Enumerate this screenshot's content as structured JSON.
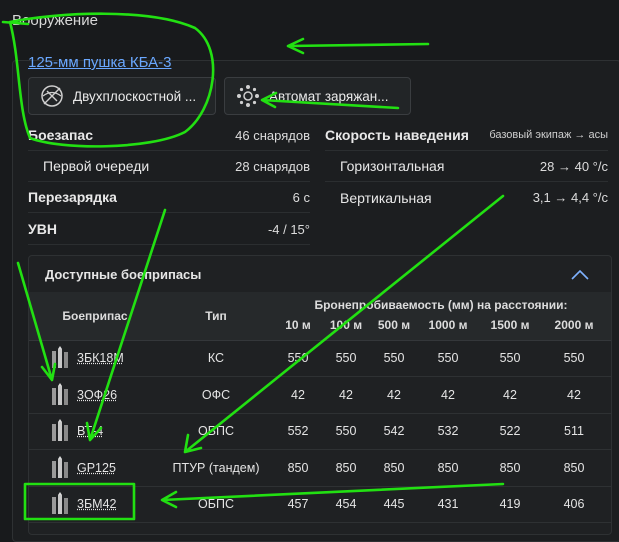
{
  "section": {
    "title": "Вооружение"
  },
  "weapon": {
    "name": "125-мм пушка КБА-3"
  },
  "modules": [
    {
      "label": "Двухплоскостной ...",
      "icon": "stabilizer-icon"
    },
    {
      "label": "Автомат заряжан...",
      "icon": "autoloader-icon"
    }
  ],
  "stats_left": [
    {
      "label": "Боезапас",
      "value": "46 снарядов"
    },
    {
      "label": "Первой очереди",
      "value": "28 снарядов"
    },
    {
      "label": "Перезарядка",
      "value": "6 с"
    },
    {
      "label": "УВН",
      "value": "-4 / 15°"
    }
  ],
  "stats_right": [
    {
      "label": "Скорость наведения",
      "value": "базовый экипаж → асы"
    },
    {
      "label": "Горизонтальная",
      "value": "28 → 40 °/с"
    },
    {
      "label": "Вертикальная",
      "value": "3,1 → 4,4 °/с"
    }
  ],
  "ammo": {
    "title": "Доступные боеприпасы",
    "col_ammo": "Боеприпас",
    "col_type": "Тип",
    "col_pen": "Бронепробиваемость (мм) на расстоянии:",
    "distances": [
      "10 м",
      "100 м",
      "500 м",
      "1000 м",
      "1500 м",
      "2000 м"
    ],
    "rows": [
      {
        "name": "3БК18М",
        "type": "КС",
        "pen": [
          "550",
          "550",
          "550",
          "550",
          "550",
          "550"
        ]
      },
      {
        "name": "3ОФ26",
        "type": "ОФС",
        "pen": [
          "42",
          "42",
          "42",
          "42",
          "42",
          "42"
        ]
      },
      {
        "name": "ВТ-4",
        "type": "ОБПС",
        "pen": [
          "552",
          "550",
          "542",
          "532",
          "522",
          "511"
        ]
      },
      {
        "name": "GP125",
        "type": "ПТУР (тандем)",
        "pen": [
          "850",
          "850",
          "850",
          "850",
          "850",
          "850"
        ]
      },
      {
        "name": "3БМ42",
        "type": "ОБПС",
        "pen": [
          "457",
          "454",
          "445",
          "431",
          "419",
          "406"
        ]
      }
    ]
  },
  "colors": {
    "annotation": "#22e012",
    "link": "#6aa8ff"
  }
}
